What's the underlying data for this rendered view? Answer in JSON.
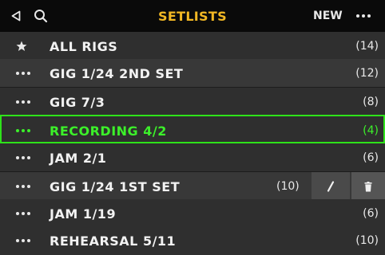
{
  "header": {
    "title": "SETLISTS",
    "new_label": "NEW",
    "icons": [
      "back-icon",
      "search-icon",
      "more-icon"
    ]
  },
  "setlists": [
    {
      "name": "ALL RIGS",
      "count": "(14)",
      "icon": "star-icon"
    },
    {
      "name": "GIG 1/24 2ND SET",
      "count": "(12)",
      "icon": "more-icon"
    },
    {
      "name": "GIG 7/3",
      "count": "(8)",
      "icon": "more-icon"
    },
    {
      "name": "RECORDING 4/2",
      "count": "(4)",
      "icon": "more-icon",
      "selected": true
    },
    {
      "name": "JAM 2/1",
      "count": "(6)",
      "icon": "more-icon"
    },
    {
      "name": "GIG 1/24 1ST SET",
      "count": "(10)",
      "icon": "more-icon",
      "actions": [
        "edit-icon",
        "trash-icon"
      ]
    },
    {
      "name": "JAM 1/19",
      "count": "(6)",
      "icon": "more-icon"
    },
    {
      "name": "REHEARSAL 5/11",
      "count": "(10)",
      "icon": "more-icon"
    }
  ],
  "colors": {
    "accent_title": "#f2b824",
    "selected": "#3cf02a",
    "row_bg": "#2f2f2f",
    "header_bg": "#0a0a0a"
  }
}
